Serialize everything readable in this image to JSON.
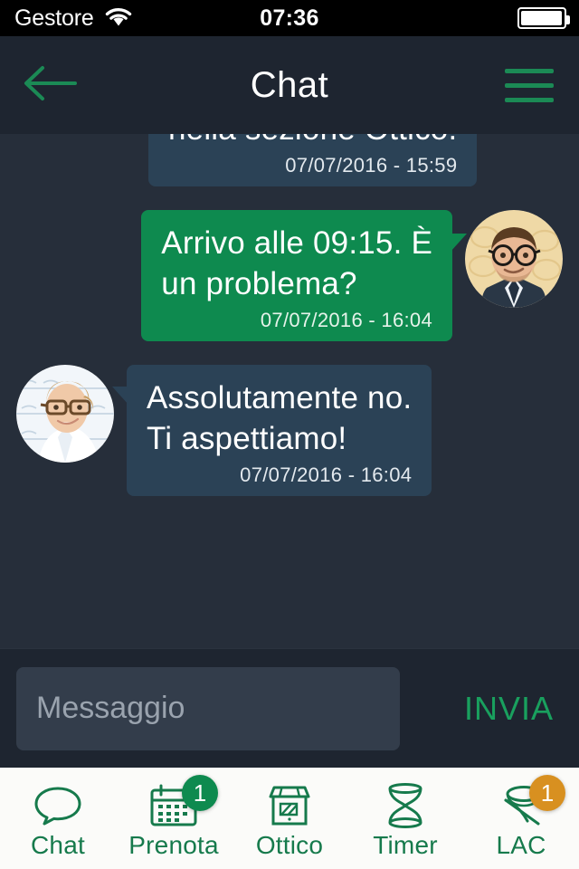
{
  "status_bar": {
    "carrier": "Gestore",
    "wifi_icon": "wifi-icon",
    "time": "07:36",
    "battery_icon": "battery-icon"
  },
  "header": {
    "back_icon": "back-arrow-icon",
    "title": "Chat",
    "menu_icon": "hamburger-menu-icon"
  },
  "messages": [
    {
      "direction": "in",
      "text": "nella sezione Ottico.",
      "time": "07/07/2016 - 15:59",
      "avatar": "none"
    },
    {
      "direction": "out",
      "text": "Arrivo alle 09:15. È\nun problema?",
      "time": "07/07/2016 - 16:04",
      "avatar": "avatar-male-customer"
    },
    {
      "direction": "in",
      "text": "Assolutamente no.\nTi aspettiamo!",
      "time": "07/07/2016 - 16:04",
      "avatar": "avatar-female-optician"
    }
  ],
  "composer": {
    "placeholder": "Messaggio",
    "value": "",
    "send_label": "INVIA"
  },
  "tabbar": {
    "items": [
      {
        "label": "Chat",
        "icon": "speech-bubble-icon",
        "badge": null,
        "badge_color": null,
        "active": true
      },
      {
        "label": "Prenota",
        "icon": "calendar-icon",
        "badge": "1",
        "badge_color": "#0E8A4F",
        "active": false
      },
      {
        "label": "Ottico",
        "icon": "storefront-icon",
        "badge": null,
        "badge_color": null,
        "active": false
      },
      {
        "label": "Timer",
        "icon": "hourglass-icon",
        "badge": null,
        "badge_color": null,
        "active": false
      },
      {
        "label": "LAC",
        "icon": "contact-lens-icon",
        "badge": "1",
        "badge_color": "#D89020",
        "active": false
      }
    ]
  },
  "colors": {
    "accent_green": "#0E8A4F",
    "chat_background": "#262E3A",
    "header_background": "#1E2530",
    "incoming_bubble": "#2B4256",
    "outgoing_bubble": "#0E8A4F",
    "tabbar_background": "#FBFBF9",
    "badge_orange": "#D89020"
  }
}
